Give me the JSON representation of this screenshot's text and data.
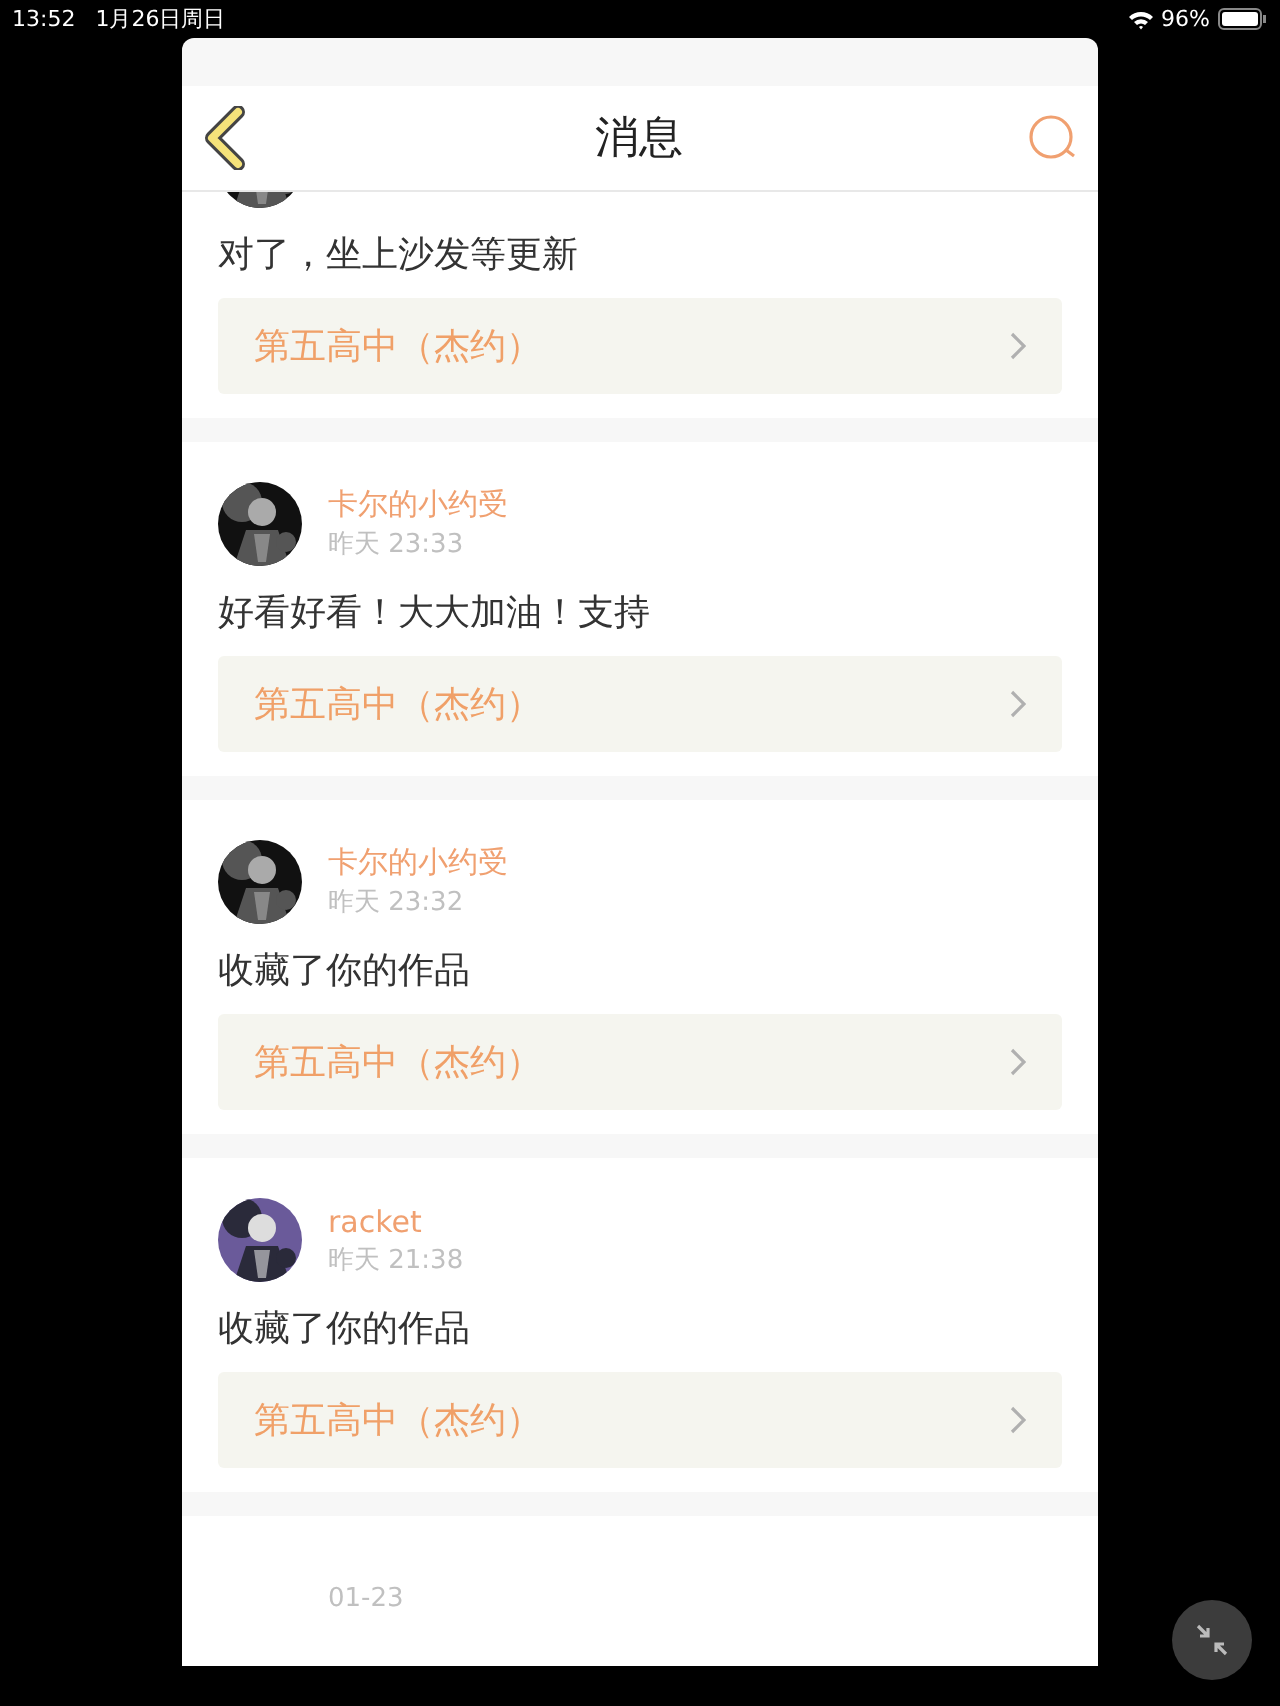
{
  "status_bar": {
    "time": "13:52",
    "date": "1月26日周日",
    "battery": "96%"
  },
  "header": {
    "title": "消息"
  },
  "messages": [
    {
      "comment": "对了，坐上沙发等更新",
      "work": "第五高中（杰约）"
    },
    {
      "name": "卡尔的小约受",
      "time": "昨天 23:33",
      "comment": "好看好看！大大加油！支持",
      "work": "第五高中（杰约）"
    },
    {
      "name": "卡尔的小约受",
      "time": "昨天 23:32",
      "comment": "收藏了你的作品",
      "work": "第五高中（杰约）"
    },
    {
      "name": "racket",
      "time": "昨天 21:38",
      "comment": "收藏了你的作品",
      "work": "第五高中（杰约）"
    },
    {
      "time": "01-23"
    }
  ]
}
